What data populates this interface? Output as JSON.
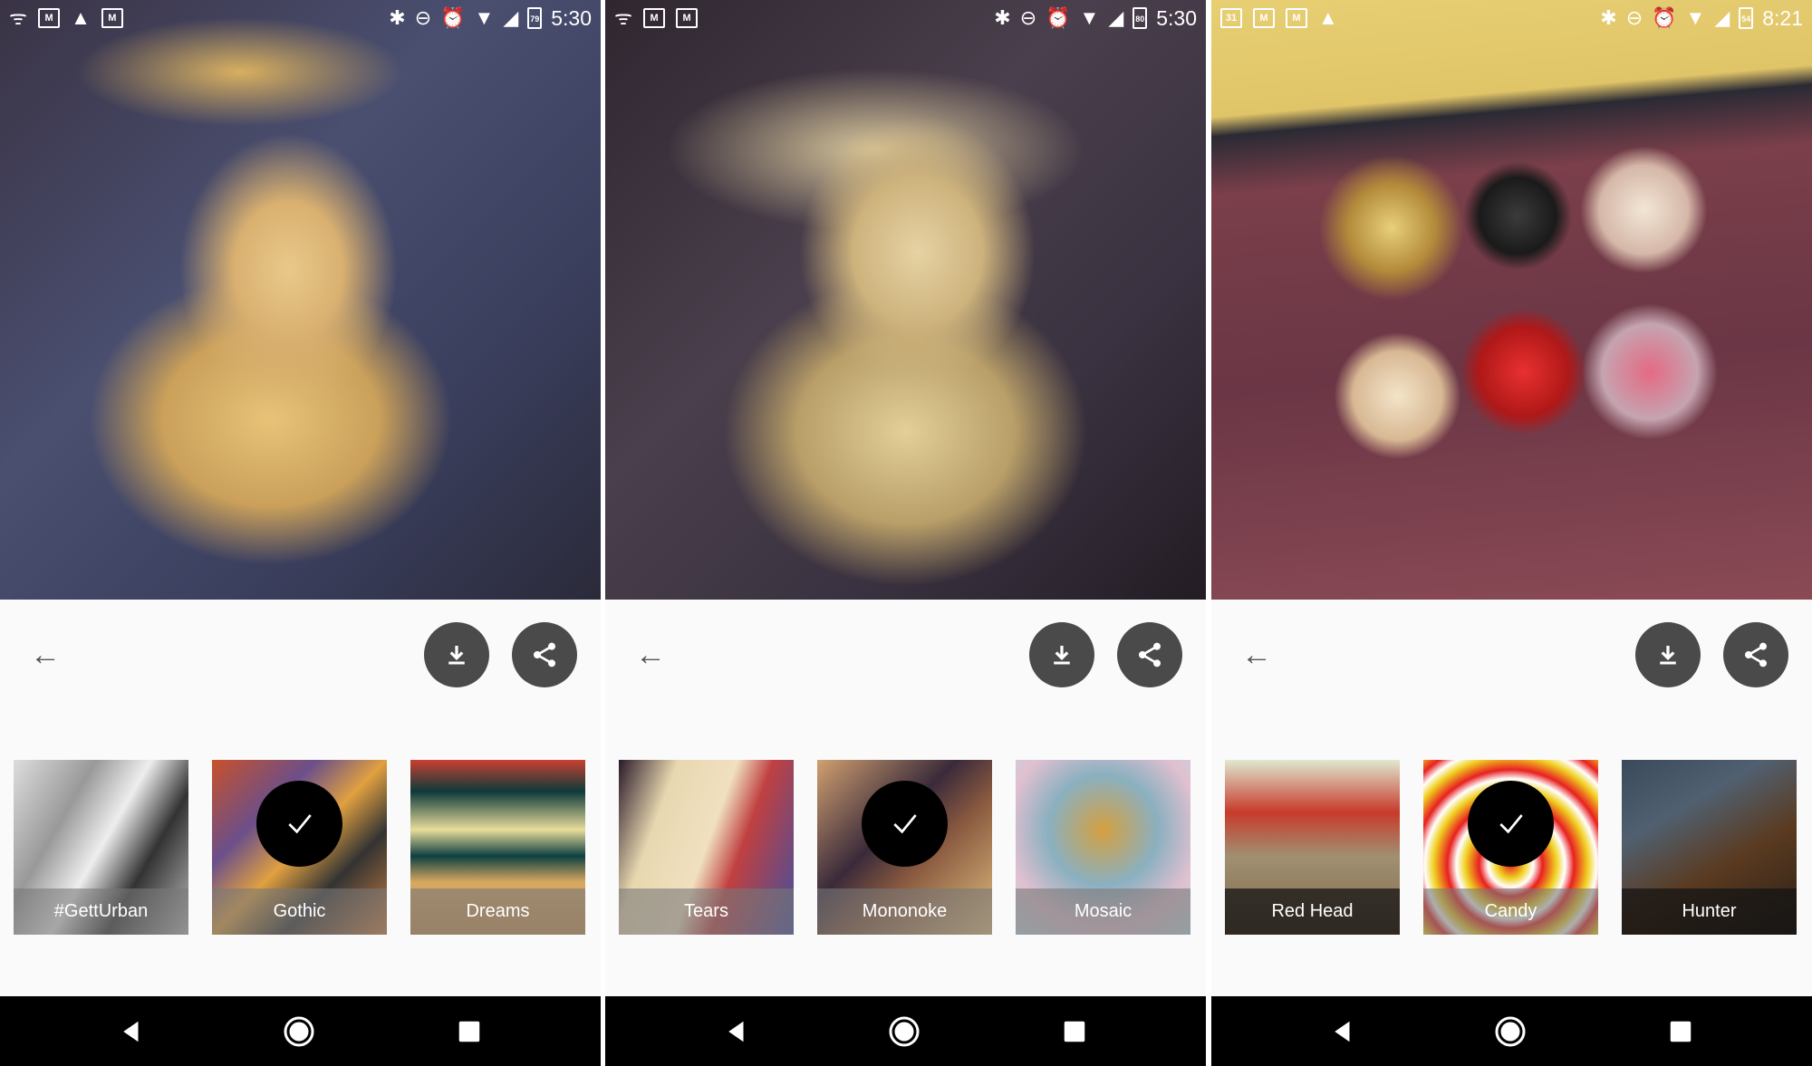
{
  "panels": [
    {
      "status": {
        "left_icons": [
          "wifi-calling-icon",
          "gmail-icon",
          "image-icon",
          "gmail-icon"
        ],
        "right_icons": [
          "bluetooth-icon",
          "do-not-disturb-icon",
          "alarm-icon",
          "wifi-icon",
          "signal-icon"
        ],
        "battery": "79",
        "time": "5:30"
      },
      "photo": "dog-painting-gothic",
      "styles": [
        {
          "label": "#GettUrban",
          "selected": false
        },
        {
          "label": "Gothic",
          "selected": true
        },
        {
          "label": "Dreams",
          "selected": false
        }
      ]
    },
    {
      "status": {
        "left_icons": [
          "wifi-calling-icon",
          "gmail-icon",
          "gmail-icon"
        ],
        "right_icons": [
          "bluetooth-icon",
          "do-not-disturb-icon",
          "alarm-icon",
          "wifi-icon",
          "signal-icon"
        ],
        "battery": "80",
        "time": "5:30"
      },
      "photo": "dog-painting-mononoke",
      "styles": [
        {
          "label": "Tears",
          "selected": false
        },
        {
          "label": "Mononoke",
          "selected": true
        },
        {
          "label": "Mosaic",
          "selected": false
        }
      ]
    },
    {
      "status": {
        "left_icons": [
          "calendar-icon",
          "gmail-icon",
          "gmail-icon",
          "image-icon"
        ],
        "calendar_day": "31",
        "right_icons": [
          "bluetooth-icon",
          "do-not-disturb-icon",
          "alarm-icon",
          "wifi-icon",
          "signal-icon"
        ],
        "battery": "54",
        "time": "8:21"
      },
      "photo": "masks-painting-candy",
      "styles": [
        {
          "label": "Red Head",
          "selected": false,
          "dark": true
        },
        {
          "label": "Candy",
          "selected": true
        },
        {
          "label": "Hunter",
          "selected": false,
          "dark": true
        }
      ]
    }
  ],
  "controls": {
    "back": "back-arrow-icon",
    "download": "download-icon",
    "share": "share-icon"
  },
  "nav": [
    "nav-back-icon",
    "nav-home-icon",
    "nav-recents-icon"
  ],
  "colors": {
    "button_bg": "#4a4a4a",
    "panel_bg": "#fafafa",
    "nav_bg": "#000000"
  }
}
